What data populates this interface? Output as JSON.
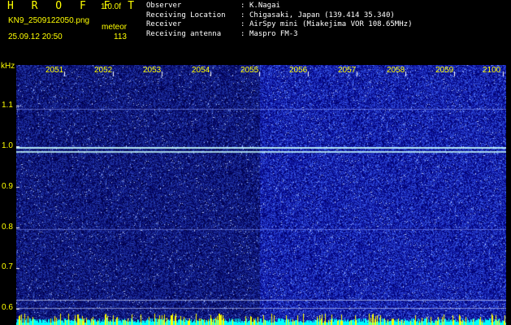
{
  "header": {
    "title": "H R O F F T",
    "version": "1.0.0f",
    "filename": "KN9_2509122050.png",
    "meteor_label": "meteor",
    "datetime": "25.09.12 20:50",
    "meteor_count": "113"
  },
  "info": [
    {
      "label": "Observer",
      "value": "K.Nagai"
    },
    {
      "label": "Receiving Location",
      "value": "Chigasaki, Japan (139.414 35.340)"
    },
    {
      "label": "Receiver",
      "value": "AirSpy mini (Miakejima VOR 108.65MHz)"
    },
    {
      "label": "Receiving antenna",
      "value": "Maspro FM-3"
    }
  ],
  "axis": {
    "y_unit": "kHz",
    "y_ticks": [
      "1.1",
      "1.0",
      "0.9",
      "0.8",
      "0.7",
      "0.6"
    ],
    "time_labels": [
      "2051",
      "2052",
      "2053",
      "2054",
      "2055",
      "2056",
      "2057",
      "2058",
      "2059",
      "2100"
    ]
  },
  "colors": {
    "background": "#000000",
    "text_header": "#ffff00",
    "text_info": "#ffffff",
    "noise_base": "#000a6e",
    "noise_bright": "#5a64ff",
    "carrier_line": "#c8ffff",
    "level_cyan": "#00ffff",
    "level_yellow": "#ffff00"
  }
}
